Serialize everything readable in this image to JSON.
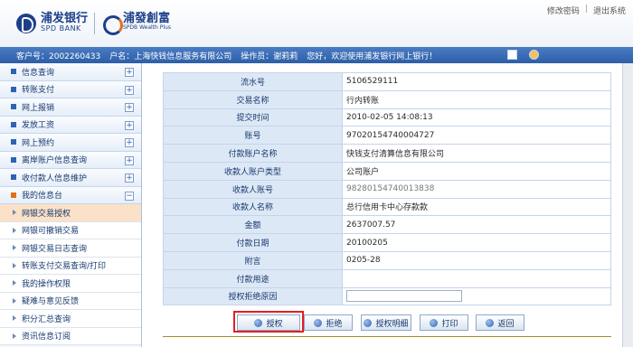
{
  "header": {
    "bank_name_cn": "浦发银行",
    "bank_name_en": "SPD BANK",
    "wealth_name_cn": "浦發創富",
    "wealth_name_en": "SPDB Wealth Plus",
    "link_change_password": "修改密码",
    "link_logout": "退出系统"
  },
  "infobar": {
    "customer_no": "客户号：2002260433",
    "account_name": "户名：上海快钱信息服务有限公司",
    "operator": "操作员：谢莉莉",
    "welcome": "您好，欢迎使用浦发银行网上银行！"
  },
  "sidebar": {
    "menus": [
      {
        "label": "信息查询"
      },
      {
        "label": "转账支付"
      },
      {
        "label": "网上报销"
      },
      {
        "label": "发放工资"
      },
      {
        "label": "网上预约"
      },
      {
        "label": "离岸账户信息查询"
      },
      {
        "label": "收付款人信息维护"
      },
      {
        "label": "我的信息台"
      }
    ],
    "sub_items": [
      {
        "label": "网银交易授权"
      },
      {
        "label": "网银可撤销交易"
      },
      {
        "label": "网银交易日志查询"
      },
      {
        "label": "转账支付交易查询/打印"
      },
      {
        "label": "我的操作权限"
      },
      {
        "label": "疑难与意见反馈"
      },
      {
        "label": "积分汇总查询"
      },
      {
        "label": "资讯信息订阅"
      }
    ]
  },
  "detail": {
    "rows": [
      {
        "label": "流水号",
        "value": "5106529111"
      },
      {
        "label": "交易名称",
        "value": "行内转账"
      },
      {
        "label": "提交时间",
        "value": "2010-02-05 14:08:13"
      },
      {
        "label": "账号",
        "value": "97020154740004727"
      },
      {
        "label": "付款账户名称",
        "value": "快钱支付清算信息有限公司"
      },
      {
        "label": "收款人账户类型",
        "value": "公司账户"
      },
      {
        "label": "收款人账号",
        "value": "98280154740013838"
      },
      {
        "label": "收款人名称",
        "value": "总行信用卡中心存款款"
      },
      {
        "label": "金额",
        "value": "2637007.57"
      },
      {
        "label": "付款日期",
        "value": "20100205"
      },
      {
        "label": "附言",
        "value": "0205-28"
      },
      {
        "label": "付款用途",
        "value": ""
      },
      {
        "label": "授权拒绝原因",
        "value": ""
      }
    ]
  },
  "buttons": {
    "authorize": "授权",
    "reject": "拒绝",
    "details": "授权明细",
    "print": "打印",
    "back": "返回"
  },
  "colors": {
    "brand_blue": "#1c3f8a",
    "infobar_blue": "#2d5fa8",
    "label_cell_bg": "#dde8f6",
    "active_item_bg": "#fbe1c8",
    "highlight_red": "#e02020"
  }
}
